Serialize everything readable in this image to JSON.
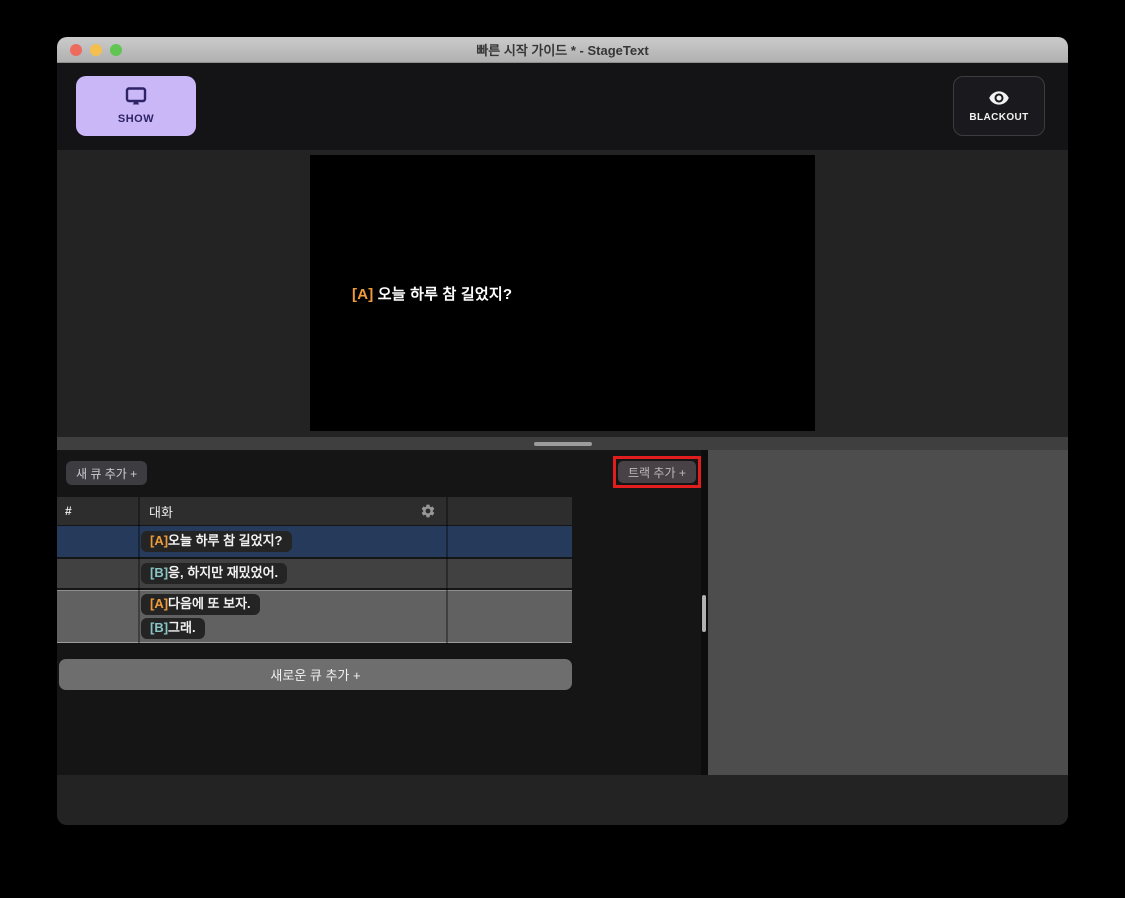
{
  "window": {
    "title": "빠른 시작 가이드 * - StageText"
  },
  "toolbar": {
    "show_label": "SHOW",
    "blackout_label": "BLACKOUT"
  },
  "preview": {
    "speaker_tag": "[A]",
    "line_text": " 오늘 하루 참 길었지?"
  },
  "cue_panel": {
    "add_cue_button": "새 큐 추가 +",
    "add_track_button": "트랙 추가 +",
    "add_new_cue_button": "새로운 큐 추가 +",
    "table": {
      "columns": [
        "#",
        "대화",
        ""
      ],
      "rows": [
        {
          "selected": true,
          "chips": [
            {
              "tag": "[A]",
              "text": "오늘 하루 참 길었지?"
            }
          ]
        },
        {
          "selected": false,
          "chips": [
            {
              "tag": "[B]",
              "text": "응, 하지만 재밌었어."
            }
          ]
        },
        {
          "selected": false,
          "chips": [
            {
              "tag": "[A]",
              "text": "다음에 또 보자."
            },
            {
              "tag": "[B]",
              "text": "그래."
            }
          ]
        }
      ]
    }
  },
  "colors": {
    "accent_purple": "#c9b7f7",
    "speaker_a": "#ef9b3a",
    "speaker_b": "#8ac6c6",
    "selected_row": "#263b5c",
    "tutorial_highlight_red": "#e21d1d"
  }
}
